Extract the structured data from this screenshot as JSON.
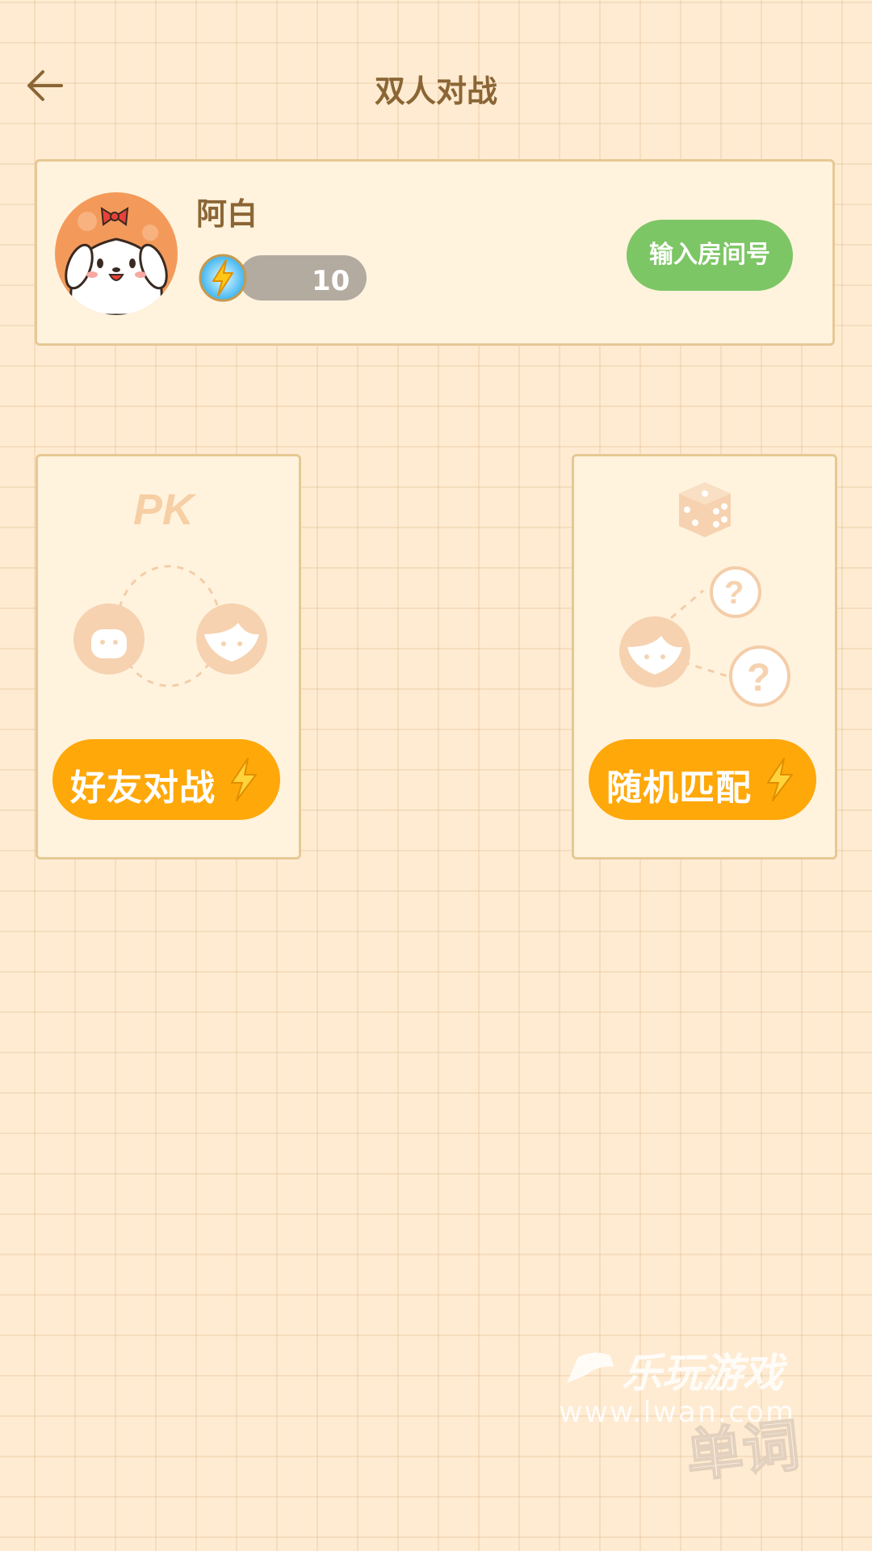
{
  "header": {
    "title": "双人对战",
    "back_icon": "arrow-left-icon"
  },
  "profile": {
    "username": "阿白",
    "energy": "10",
    "energy_icon": "lightning-icon",
    "room_button": "输入房间号"
  },
  "modes": {
    "friend": {
      "label": "好友对战",
      "art": "pk-two-faces",
      "icon": "lightning-icon"
    },
    "random": {
      "label": "随机匹配",
      "art": "dice-question-faces",
      "icon": "lightning-icon"
    }
  },
  "watermark": {
    "line1": "乐玩游戏",
    "line2": "www.lwan.com",
    "line3": "单词"
  },
  "colors": {
    "accent_orange": "#ffa80a",
    "accent_green": "#7dc665",
    "text_brown": "#8b6635",
    "background": "#feebd2"
  }
}
